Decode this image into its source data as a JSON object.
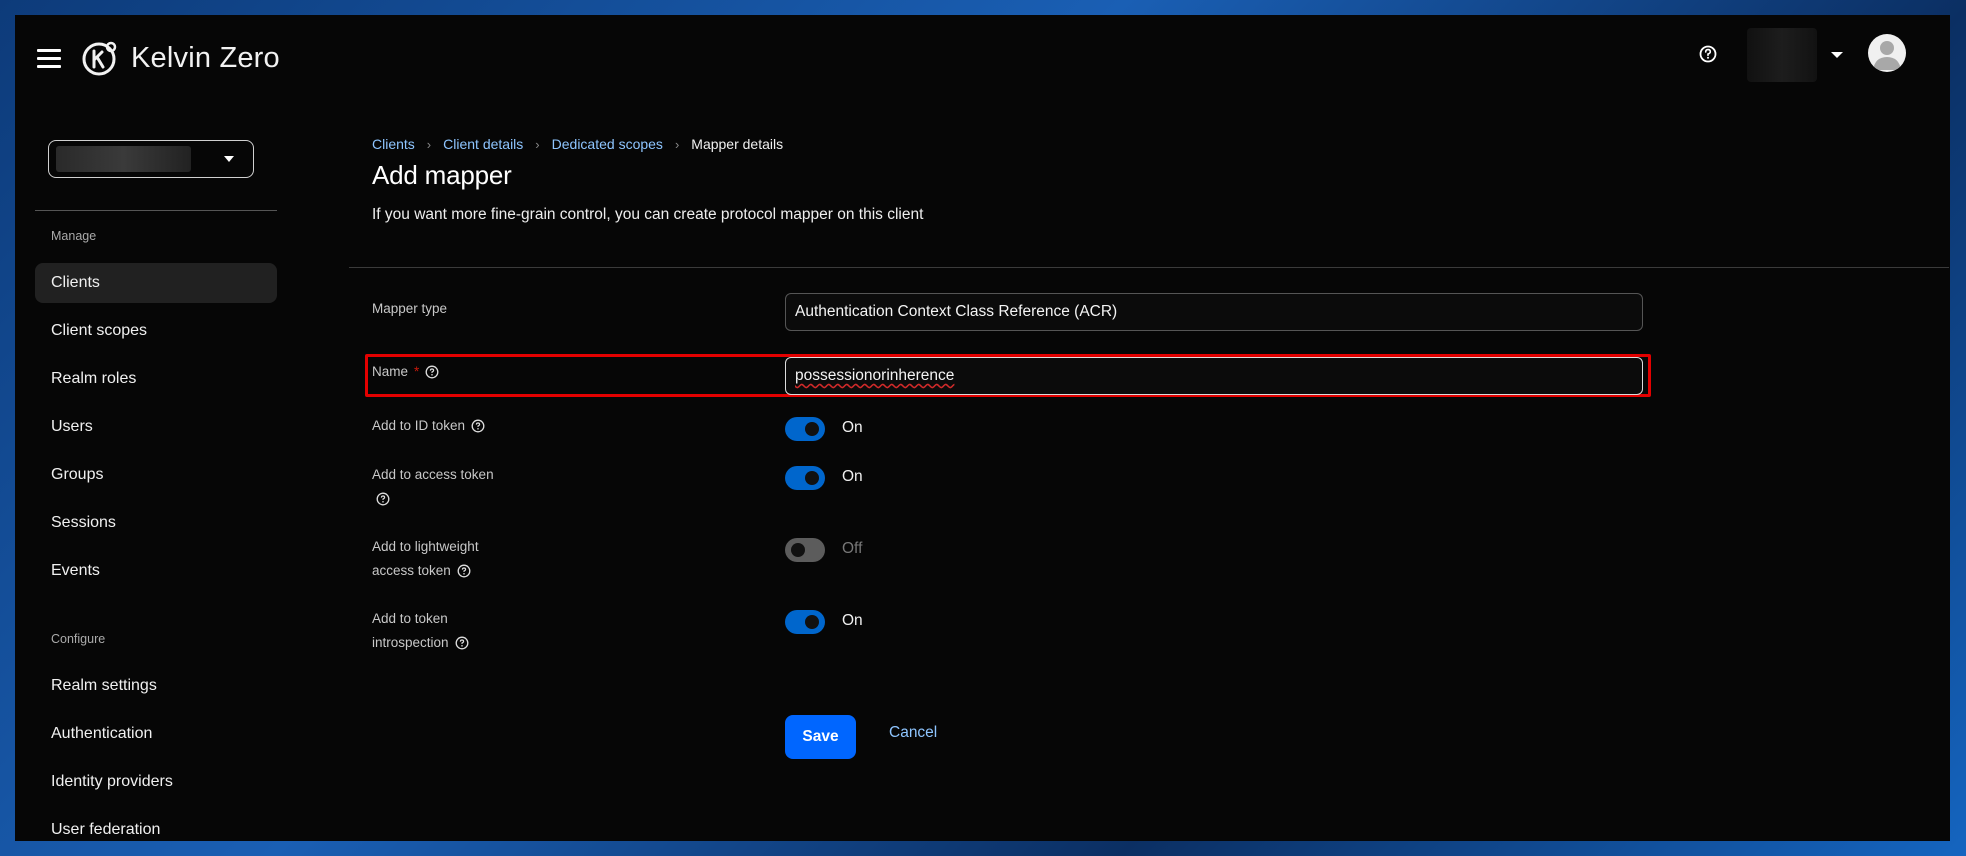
{
  "masthead": {
    "brand": "Kelvin Zero",
    "icons": {
      "menu": "hamburger-icon",
      "help": "help-circle-icon",
      "avatar": "user-avatar-icon"
    }
  },
  "sidebar": {
    "sections": [
      {
        "label": "Manage",
        "items": [
          "Clients",
          "Client scopes",
          "Realm roles",
          "Users",
          "Groups",
          "Sessions",
          "Events"
        ]
      },
      {
        "label": "Configure",
        "items": [
          "Realm settings",
          "Authentication",
          "Identity providers",
          "User federation"
        ]
      }
    ],
    "active_item": "Clients"
  },
  "breadcrumb": {
    "items": [
      "Clients",
      "Client details",
      "Dedicated scopes"
    ],
    "current": "Mapper details"
  },
  "page": {
    "title": "Add mapper",
    "description": "If you want more fine-grain control, you can create protocol mapper on this client"
  },
  "form": {
    "mapper_type": {
      "label": "Mapper type",
      "value": "Authentication Context Class Reference (ACR)"
    },
    "name": {
      "label": "Name",
      "required_mark": "*",
      "value": "possessionorinherence"
    },
    "add_to_id_token": {
      "label": "Add to ID token",
      "state": "On",
      "checked": true
    },
    "add_to_access_token": {
      "label": "Add to access token",
      "state": "On",
      "checked": true
    },
    "add_to_lightweight": {
      "label_line1": "Add to lightweight",
      "label_line2": "access token",
      "state": "Off",
      "checked": false
    },
    "add_to_introspection": {
      "label_line1": "Add to token",
      "label_line2": "introspection",
      "state": "On",
      "checked": true
    }
  },
  "actions": {
    "save_label": "Save",
    "cancel_label": "Cancel"
  },
  "colors": {
    "accent": "#0066ff",
    "link": "#8ec5ff",
    "highlight": "#e30000",
    "background": "#060606"
  }
}
